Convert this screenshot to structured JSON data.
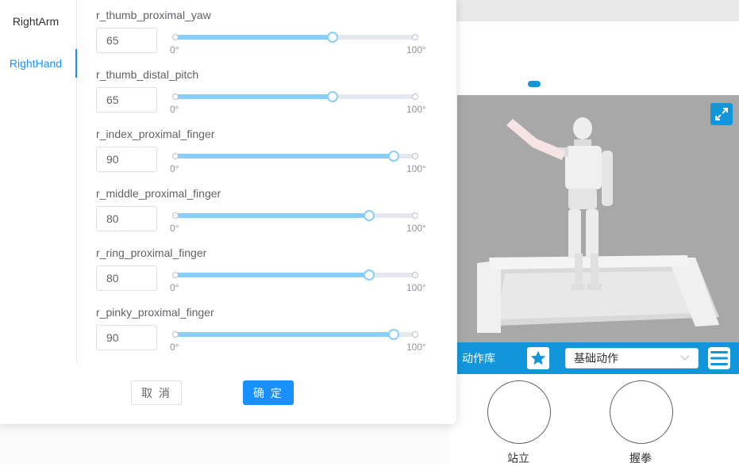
{
  "tabs": [
    {
      "label": "RightArm",
      "active": false
    },
    {
      "label": "RightHand",
      "active": true
    }
  ],
  "joints": [
    {
      "name": "r_thumb_proximal_yaw",
      "value": "65",
      "fraction": 0.65
    },
    {
      "name": "r_thumb_distal_pitch",
      "value": "65",
      "fraction": 0.65
    },
    {
      "name": "r_index_proximal_finger",
      "value": "90",
      "fraction": 0.9
    },
    {
      "name": "r_middle_proximal_finger",
      "value": "80",
      "fraction": 0.8
    },
    {
      "name": "r_ring_proximal_finger",
      "value": "80",
      "fraction": 0.8
    },
    {
      "name": "r_pinky_proximal_finger",
      "value": "90",
      "fraction": 0.9
    }
  ],
  "slider": {
    "min_label": "0°",
    "max_label": "100°"
  },
  "dialog": {
    "cancel_label": "取 消",
    "ok_label": "确 定"
  },
  "action_bar": {
    "library_label": "动作库",
    "selected_action": "基础动作"
  },
  "poses": [
    {
      "label": "站立"
    },
    {
      "label": "握拳"
    }
  ],
  "colors": {
    "accent": "#1890ff",
    "bar_blue": "#1296db",
    "slider_fill": "#87cefa"
  }
}
